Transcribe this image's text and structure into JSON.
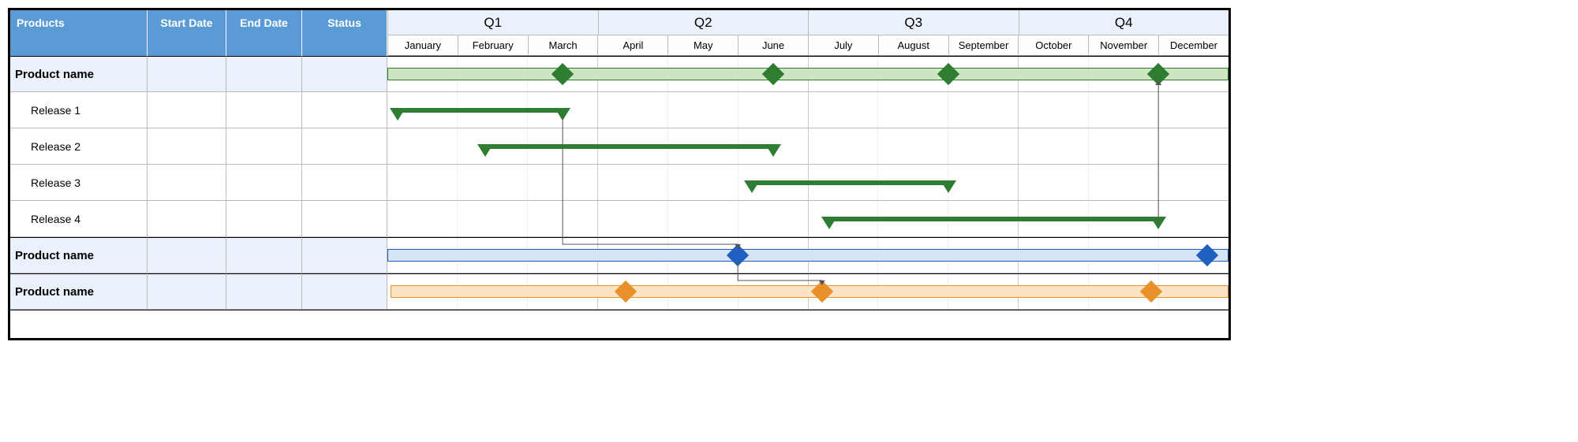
{
  "chart_data": {
    "type": "gantt",
    "time_axis": {
      "unit": "month",
      "start": 0,
      "end": 12
    },
    "rows": [
      {
        "kind": "summary",
        "label": "Product name",
        "color": "green",
        "bar": [
          0,
          12
        ],
        "milestones": [
          2.5,
          5.5,
          8,
          11
        ]
      },
      {
        "kind": "task",
        "label": "Release 1",
        "bar": [
          0.15,
          2.5
        ]
      },
      {
        "kind": "task",
        "label": "Release 2",
        "bar": [
          1.4,
          5.5
        ]
      },
      {
        "kind": "task",
        "label": "Release 3",
        "bar": [
          5.2,
          8
        ]
      },
      {
        "kind": "task",
        "label": "Release 4",
        "bar": [
          6.3,
          11
        ]
      },
      {
        "kind": "summary",
        "label": "Product name",
        "color": "blue",
        "bar": [
          0,
          12
        ],
        "milestones": [
          5,
          11.7
        ]
      },
      {
        "kind": "summary",
        "label": "Product name",
        "color": "orange",
        "bar": [
          0.05,
          12
        ],
        "milestones": [
          3.4,
          6.2,
          10.9
        ]
      }
    ],
    "dependencies": [
      {
        "from_row": 1,
        "from_month": 2.5,
        "to_row": 5,
        "to_month": 5
      },
      {
        "from_row": 4,
        "from_month": 11,
        "to_row": 0,
        "to_month": 11
      },
      {
        "from_row": 5,
        "from_month": 5,
        "to_row": 6,
        "to_month": 6.2
      }
    ]
  },
  "headers": {
    "products": "Products",
    "start_date": "Start Date",
    "end_date": "End Date",
    "status": "Status",
    "quarters": [
      "Q1",
      "Q2",
      "Q3",
      "Q4"
    ],
    "months": [
      "January",
      "February",
      "March",
      "April",
      "May",
      "June",
      "July",
      "August",
      "September",
      "October",
      "November",
      "December"
    ]
  },
  "rows": [
    {
      "label": "Product name",
      "start": "",
      "end": "",
      "status": ""
    },
    {
      "label": "Release 1",
      "start": "",
      "end": "",
      "status": ""
    },
    {
      "label": "Release 2",
      "start": "",
      "end": "",
      "status": ""
    },
    {
      "label": "Release 3",
      "start": "",
      "end": "",
      "status": ""
    },
    {
      "label": "Release 4",
      "start": "",
      "end": "",
      "status": ""
    },
    {
      "label": "Product name",
      "start": "",
      "end": "",
      "status": ""
    },
    {
      "label": "Product name",
      "start": "",
      "end": "",
      "status": ""
    }
  ]
}
